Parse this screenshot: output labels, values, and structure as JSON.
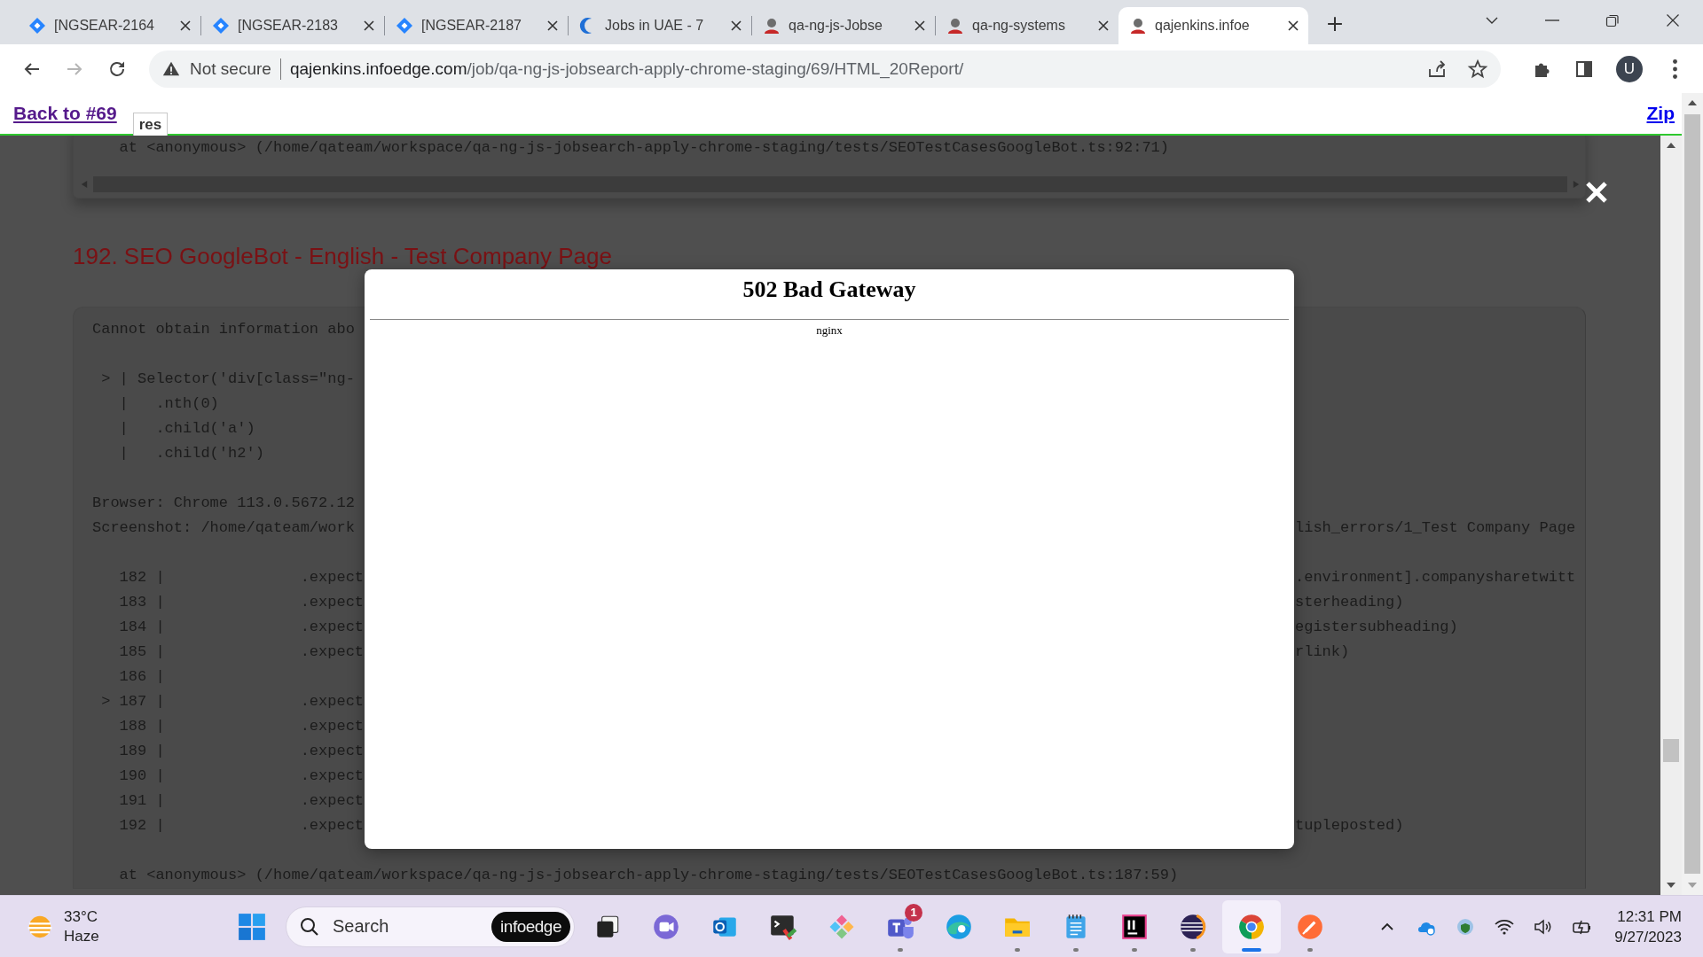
{
  "browser": {
    "tabs": [
      {
        "kind": "diamond",
        "title": "[NGSEAR-2164",
        "selected": false
      },
      {
        "kind": "diamond",
        "title": "[NGSEAR-2183",
        "selected": false
      },
      {
        "kind": "diamond",
        "title": "[NGSEAR-2187",
        "selected": false
      },
      {
        "kind": "crescent",
        "title": "Jobs in UAE - 7",
        "selected": false
      },
      {
        "kind": "person",
        "title": "qa-ng-js-Jobse",
        "selected": false
      },
      {
        "kind": "person",
        "title": "qa-ng-systems",
        "selected": false
      },
      {
        "kind": "person",
        "title": "qajenkins.infoe",
        "selected": true
      }
    ],
    "toolbar": {
      "security": "Not secure",
      "url_host": "qajenkins.infoedge.com",
      "url_path": "/job/qa-ng-js-jobsearch-apply-chrome-staging/69/HTML_20Report/",
      "profile": "U"
    }
  },
  "report": {
    "header": {
      "back_link": "Back to #69",
      "tab": "res",
      "zip_link": "Zip"
    },
    "top_snippet": "   at <anonymous> (/home/qateam/workspace/qa-ng-js-jobsearch-apply-chrome-staging/tests/SEOTestCasesGoogleBot.ts:92:71)",
    "heading": "192. SEO GoogleBot - English - Test Company Page",
    "code_lines": [
      {
        "kind": "text",
        "left": "Cannot obtain information abo"
      },
      {
        "kind": "blank"
      },
      {
        "kind": "text",
        "left": " > | Selector('div[class=\"ng-"
      },
      {
        "kind": "text",
        "left": "   |   .nth(0)"
      },
      {
        "kind": "text",
        "left": "   |   .child('a')"
      },
      {
        "kind": "text",
        "left": "   |   .child('h2')"
      },
      {
        "kind": "blank"
      },
      {
        "kind": "text",
        "left": "Browser: Chrome 113.0.5672.12"
      },
      {
        "kind": "text",
        "left": "Screenshot: /home/qateam/work",
        "right": "lish_errors/1_Test Company Page"
      },
      {
        "kind": "blank"
      },
      {
        "kind": "text",
        "left": "   182 |               .expect",
        "right": ".environment].companysharetwitt"
      },
      {
        "kind": "text",
        "left": "   183 |               .expect",
        "right": "sterheading)"
      },
      {
        "kind": "text",
        "left": "   184 |               .expect",
        "right": "egistersubheading)"
      },
      {
        "kind": "text",
        "left": "   185 |               .expect",
        "right": "rlink)"
      },
      {
        "kind": "text",
        "left": "   186 |"
      },
      {
        "kind": "text",
        "left": " > 187 |               .expect"
      },
      {
        "kind": "text",
        "left": "   188 |               .expect"
      },
      {
        "kind": "text",
        "left": "   189 |               .expect"
      },
      {
        "kind": "text",
        "left": "   190 |               .expect"
      },
      {
        "kind": "text",
        "left": "   191 |               .expect"
      },
      {
        "kind": "text",
        "left": "   192 |               .expect",
        "right": "tupleposted)"
      },
      {
        "kind": "blank"
      },
      {
        "kind": "wide",
        "left": "   at <anonymous> (/home/qateam/workspace/qa-ng-js-jobsearch-apply-chrome-staging/tests/SEOTestCasesGoogleBot.ts:187:59)"
      }
    ],
    "dialog": {
      "title": "502 Bad Gateway",
      "server": "nginx"
    }
  },
  "taskbar": {
    "weather": {
      "temperature": "33°C",
      "condition": "Haze"
    },
    "search": {
      "placeholder": "Search",
      "badge": "infoedge"
    },
    "apps": [
      {
        "kind": "stack",
        "running": false,
        "active": false
      },
      {
        "kind": "chat",
        "running": false,
        "active": false
      },
      {
        "kind": "mail",
        "running": false,
        "active": false
      },
      {
        "kind": "terminal",
        "running": false,
        "active": false
      },
      {
        "kind": "diamond",
        "running": false,
        "active": false
      },
      {
        "kind": "people",
        "running": true,
        "active": false,
        "badge": "1"
      },
      {
        "kind": "wave",
        "running": false,
        "active": false
      },
      {
        "kind": "folder",
        "running": true,
        "active": false
      },
      {
        "kind": "notepad",
        "running": true,
        "active": false
      },
      {
        "kind": "ide",
        "running": true,
        "active": false
      },
      {
        "kind": "sphere",
        "running": true,
        "active": false
      },
      {
        "kind": "browser",
        "running": true,
        "active": true
      },
      {
        "kind": "pen",
        "running": true,
        "active": false
      }
    ],
    "clock": {
      "time": "12:31 PM",
      "date": "9/27/2023"
    }
  }
}
